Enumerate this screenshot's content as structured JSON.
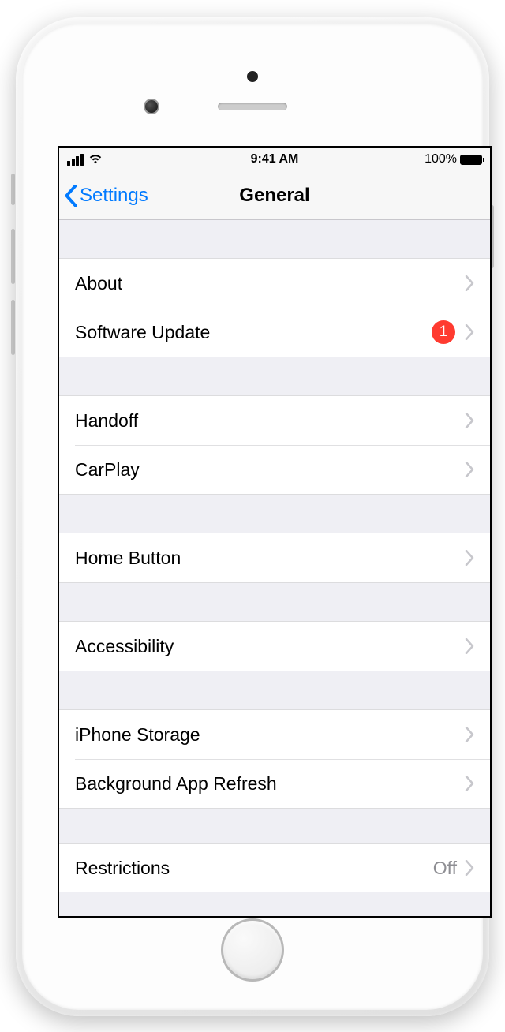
{
  "statusBar": {
    "time": "9:41 AM",
    "batteryText": "100%"
  },
  "nav": {
    "back": "Settings",
    "title": "General"
  },
  "groups": [
    {
      "rows": [
        {
          "id": "about",
          "label": "About"
        },
        {
          "id": "software-update",
          "label": "Software Update",
          "badge": "1"
        }
      ]
    },
    {
      "rows": [
        {
          "id": "handoff",
          "label": "Handoff"
        },
        {
          "id": "carplay",
          "label": "CarPlay"
        }
      ]
    },
    {
      "rows": [
        {
          "id": "home-button",
          "label": "Home Button"
        }
      ]
    },
    {
      "rows": [
        {
          "id": "accessibility",
          "label": "Accessibility"
        }
      ]
    },
    {
      "rows": [
        {
          "id": "iphone-storage",
          "label": "iPhone Storage"
        },
        {
          "id": "background-app-refresh",
          "label": "Background App Refresh"
        }
      ]
    },
    {
      "rows": [
        {
          "id": "restrictions",
          "label": "Restrictions",
          "value": "Off"
        }
      ]
    }
  ],
  "colors": {
    "tint": "#007aff",
    "badge": "#ff3b30",
    "separator": "#c8c7cc",
    "groupBg": "#efeff4"
  }
}
